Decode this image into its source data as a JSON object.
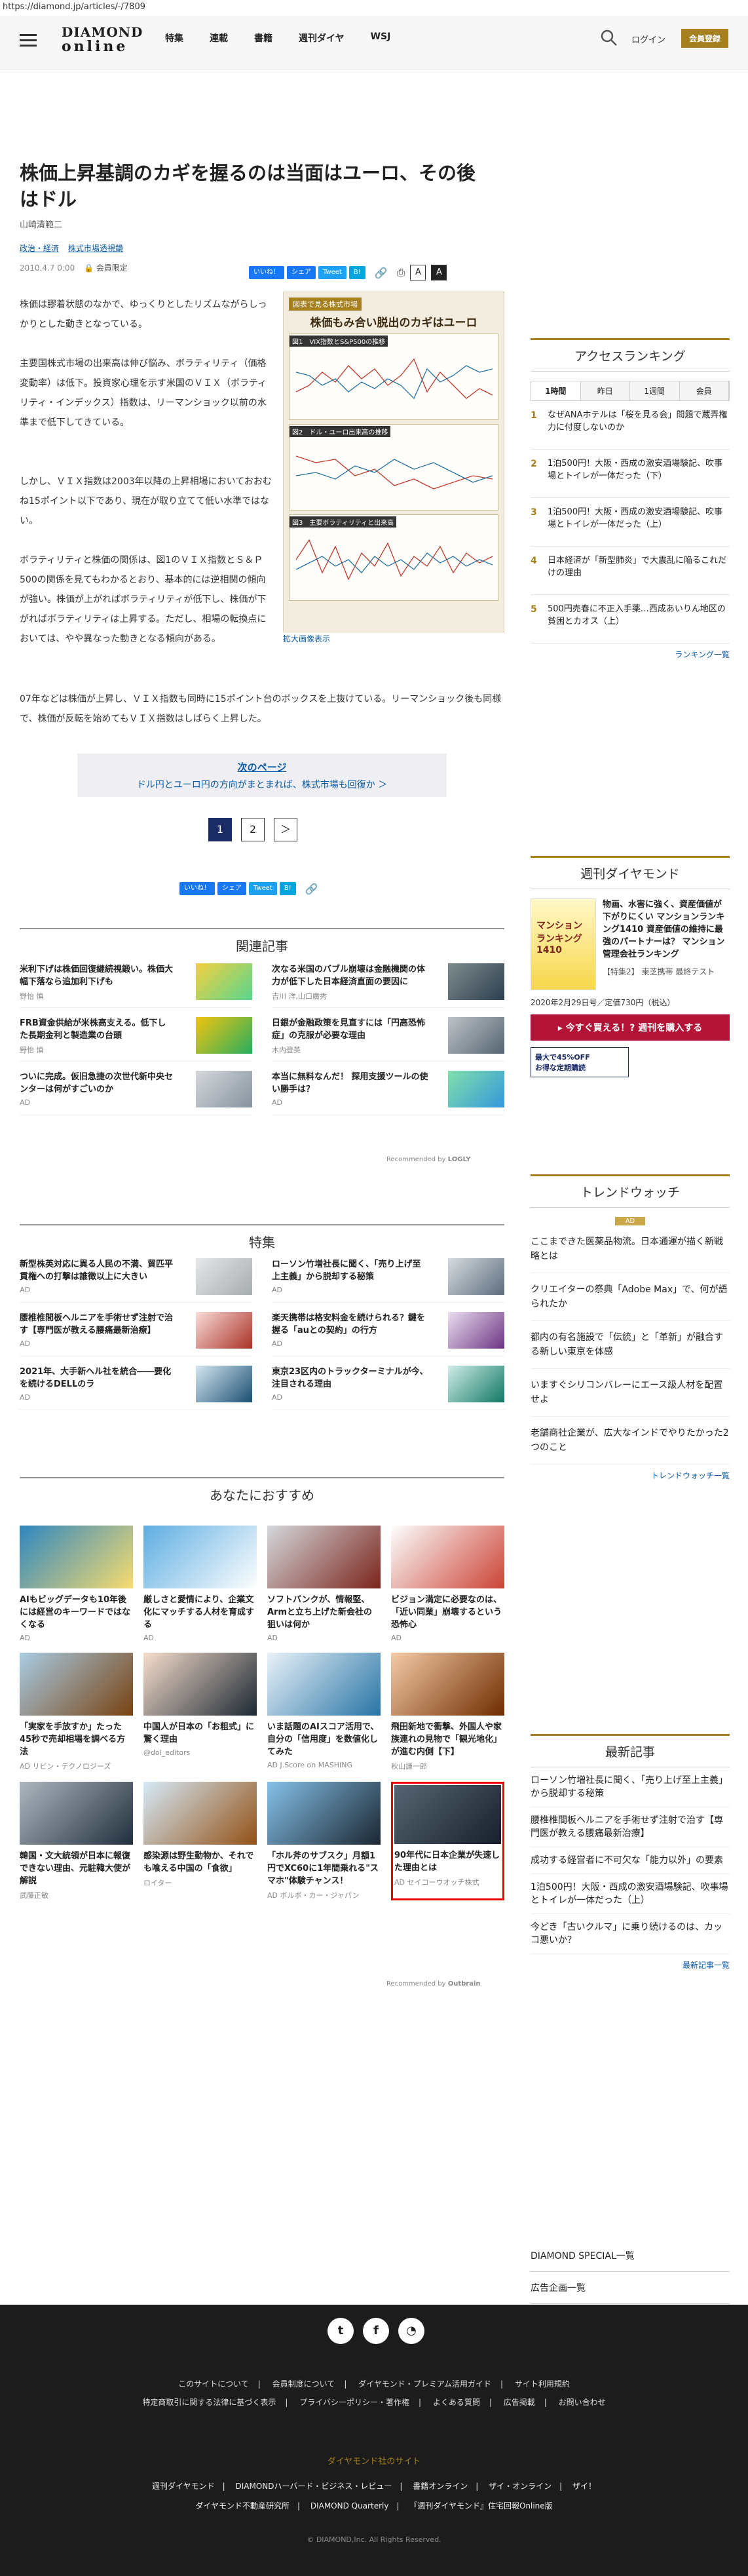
{
  "url": "https://diamond.jp/articles/-/7809",
  "header": {
    "logo_top": "DIAMOND",
    "logo_bottom": "online",
    "nav": [
      "特集",
      "連載",
      "書籍",
      "週刊ダイヤ",
      "WSJ"
    ],
    "login": "ログイン",
    "member": "会員登録"
  },
  "article": {
    "title": "株価上昇基調のカギを握るのは当面はユーロ、その後はドル",
    "author": "山崎清範二",
    "categories": [
      "政治・経済",
      "株式市場透視鏡"
    ],
    "date": "2010.4.7 0:00",
    "premium": "会員限定",
    "share": {
      "like": "いいね！",
      "share": "シェア",
      "tweet": "Tweet",
      "hatena": "B!"
    },
    "font_a": "A",
    "paragraphs": [
      "株価は膠着状態のなかで、ゆっくりとしたリズムながらしっかりとした動きとなっている。",
      "主要国株式市場の出来高は伸び悩み、ボラティリティ（価格変動率）は低下。投資家心理を示す米国のＶＩＸ（ボラティリティ・インデックス）指数は、リーマンショック以前の水準まで低下してきている。",
      "しかし、ＶＩＸ指数は2003年以降の上昇相場においておおむね15ポイント以下であり、現在が取り立てて低い水準ではない。",
      "ボラティリティと株価の関係は、図1のＶＩＸ指数とＳ＆Ｐ500の関係を見てもわかるとおり、基本的には逆相関の傾向が強い。株価が上がればボラティリティが低下し、株価が下がればボラティリティは上昇する。ただし、相場の転換点においては、やや異なった動きとなる傾向がある。",
      "07年などは株価が上昇し、ＶＩＸ指数も同時に15ポイント台のボックスを上抜けている。リーマンショック後も同様で、株価が反転を始めてもＶＩＸ指数はしばらく上昇した。"
    ],
    "figure": {
      "label": "図表で見る株式市場",
      "heading": "株価もみ合い脱出のカギはユーロ",
      "panels": [
        "図1　VIX指数とS&P500の推移",
        "図2　ドル・ユーロ出来高の推移",
        "図3　主要ボラティリティと出来高"
      ],
      "caption": "拡大画像表示",
      "xticks": [
        "1997",
        "99",
        "2001",
        "03",
        "05",
        "07",
        "09"
      ]
    },
    "next": {
      "label": "次のページ",
      "text": "ドル円とユーロ円の方向がまとまれば、株式市場も回復か ＞"
    },
    "pages": [
      "1",
      "2",
      "＞"
    ]
  },
  "related": {
    "heading": "関連記事",
    "items": [
      {
        "title": "米利下げは株価回復継続視鍛い。株価大幅下落なら追加利下げも",
        "author": "野怡 慎"
      },
      {
        "title": "次なる米国のバブル崩壊は金融機関の体力が低下した日本経済直面の要因に",
        "author": "吉川 洋,山口廣秀"
      },
      {
        "title": "FRB資金供給が米株高支える。低下し た長期金利と製造業の台頭",
        "author": "野怡 慎"
      },
      {
        "title": "日銀が金融政策を見直すには「円高恐怖症」の克服が必要な理由",
        "author": "木内登英"
      },
      {
        "title": "ついに完成。仮旧急捷の次世代新中央センターは何がすごいのか",
        "author": "AD"
      },
      {
        "title": "本当に無料なんだ！ 探用支援ツールの使い勝手は？",
        "author": "AD"
      }
    ],
    "recommend": "Recommended by",
    "logly": "LOGLY"
  },
  "tokushu": {
    "heading": "特集",
    "items": [
      {
        "title": "新型株英対応に異る人民の不満、貿匹平貫権への打撃は誰徴以上に大きい",
        "author": "AD"
      },
      {
        "title": "ローソン竹増社長に聞く、「売り上げ至上主義」から脱却する秘策",
        "author": "AD"
      },
      {
        "title": "腰椎椎間板ヘルニアを手術せず注射で治す【専門医が教える腰痛最新治療】",
        "author": "AD"
      },
      {
        "title": "楽天携帯は格安料金を続けられる？鍵を握る「auとの契約」の行方",
        "author": "AD"
      },
      {
        "title": "2021年、大手新ヘル社を統合――要化を続けるDELLのラ",
        "author": "AD"
      },
      {
        "title": "東京23区内のトラックターミナルが今、注目される理由",
        "author": "AD"
      }
    ]
  },
  "foryou": {
    "heading": "あなたにおすすめ",
    "items": [
      {
        "title": "AIもビッグデータも10年後には経営のキーワードではなくなる",
        "src": "AD"
      },
      {
        "title": "厳しさと愛情により、企業文化にマッチする人材を育成する",
        "src": "AD"
      },
      {
        "title": "ソフトバンクが、情報堅、Armと立ち上げた新会社の狙いは何か",
        "src": "AD"
      },
      {
        "title": "ビジョン満定に必要なのは、「近い同業」崩壊するという恐怖心",
        "src": "AD"
      },
      {
        "title": "「実家を手放すか」たった45秒で売却相場を調べる方法",
        "src": "AD リビン・テクノロジーズ"
      },
      {
        "title": "中国人が日本の「お粗式」に驚く理由",
        "src": "@dol_editors"
      },
      {
        "title": "いま話題のAIスコア活用で、自分の「信用度」を数値化してみた",
        "src": "AD J.Score on MASHING"
      },
      {
        "title": "飛田新地で衝撃、外国人や家族連れの見物で「観光地化」が進む内側【下】",
        "src": "秋山謙一郎"
      },
      {
        "title": "韓国・文大統領が日本に報復できない理由、元駐韓大使が解説",
        "src": "武藤正敏"
      },
      {
        "title": "感染源は野生動物か、それでも喰える中国の「食欲」",
        "src": "ロイター"
      },
      {
        "title": "「ホル斧のサブスク」月額1円でXC60に1年間乗れる\"スマホ\"体験チャンス！",
        "src": "AD ボルボ・カー・ジャパン"
      },
      {
        "title": "90年代に日本企業が失速した理由とは",
        "src": "AD セイコーウオッチ株式"
      }
    ],
    "recommend": "Recommended by",
    "outbrain": "Outbrain"
  },
  "sidebar": {
    "ranking": {
      "heading": "アクセスランキング",
      "tabs": [
        "1時間",
        "昨日",
        "1週間",
        "会員"
      ],
      "items": [
        {
          "no": "1",
          "title": "なぜANAホテルは「桜を見る会」問題で蔵弄権力に付度しないのか"
        },
        {
          "no": "2",
          "title": "1泊500円！大阪・西成の激安酒場験記、吹事場とトイレが一体だった（下）"
        },
        {
          "no": "3",
          "title": "1泊500円！大阪・西成の激安酒場験記、吹事場とトイレが一体だった（上）"
        },
        {
          "no": "4",
          "title": "日本経済が「新型肺炎」で大震乱に陥るこれだけの理由"
        },
        {
          "no": "5",
          "title": "500円売春に不正入手薬…西成あいりん地区の貧困とカオス（上）"
        }
      ],
      "more": "ランキング一覧"
    },
    "weekly": {
      "heading": "週刊ダイヤモンド",
      "cover": "マンション ランキング 1410",
      "text": "物画、水害に強く、資産価値が下がりにくい マンションランキング1410 資産価値の維持に最強のパートナーは？ マンション管理会社ランキング",
      "special": "【特集2】 東芝携帯 最終テスト",
      "date": "2020年2月29日号／定価730円（税込）",
      "buy": "▸ 今すぐ買える！? 週刊を購入する",
      "sub1": "最大で45%OFF",
      "sub2": "お得な定期購読"
    },
    "trend": {
      "heading": "トレンドウォッチ",
      "badge": "AD",
      "items": [
        "ここまできた医薬品物流。日本通運が描く新戦略とは",
        "クリエイターの祭典「Adobe Max」で、何が語られたか",
        "都内の有名施設で「伝統」と「革新」が融合する新しい東京を体感",
        "いますぐシリコンバレーにエース級人材を配置せよ",
        "老舗商社企業が、広大なインドでやりたかった2つのこと"
      ],
      "more": "トレンドウォッチ一覧"
    },
    "latest": {
      "heading": "最新記事",
      "items": [
        "ローソン竹増社長に聞く、「売り上げ至上主義」から脱却する秘策",
        "腰椎椎間板ヘルニアを手術せず注射で治す【専門医が教える腰痛最新治療】",
        "成功する経営者に不可欠な「能力以外」の要素",
        "1泊500円！大阪・西成の激安酒場験記、吹事場とトイレが一体だった（上）",
        "今どき「古いクルマ」に乗り続けるのは、カッコ悪いか？"
      ],
      "more": "最新記事一覧"
    },
    "special": "DIAMOND SPECIAL一覧",
    "ad": "広告企画一覧"
  },
  "footer": {
    "links1": [
      "このサイトについて",
      "会員制度について",
      "ダイヤモンド・プレミアム活用ガイド",
      "サイト利用規約"
    ],
    "links2": [
      "特定商取引に関する法律に基づく表示",
      "プライバシーポリシー・著作権",
      "よくある質問",
      "広告掲載",
      "お問い合わせ"
    ],
    "sister": "ダイヤモンド社のサイト",
    "sites1": [
      "週刊ダイヤモンド",
      "DIAMONDハーバード・ビジネス・レビュー",
      "書籍オンライン",
      "ザイ・オンライン",
      "ザイ！"
    ],
    "sites2": [
      "ダイヤモンド不動産研究所",
      "DIAMOND Quarterly",
      "『週刊ダイヤモンド』住宅回報Online版"
    ],
    "copyright": "DIAMOND,Inc. All Rights Reserved."
  }
}
